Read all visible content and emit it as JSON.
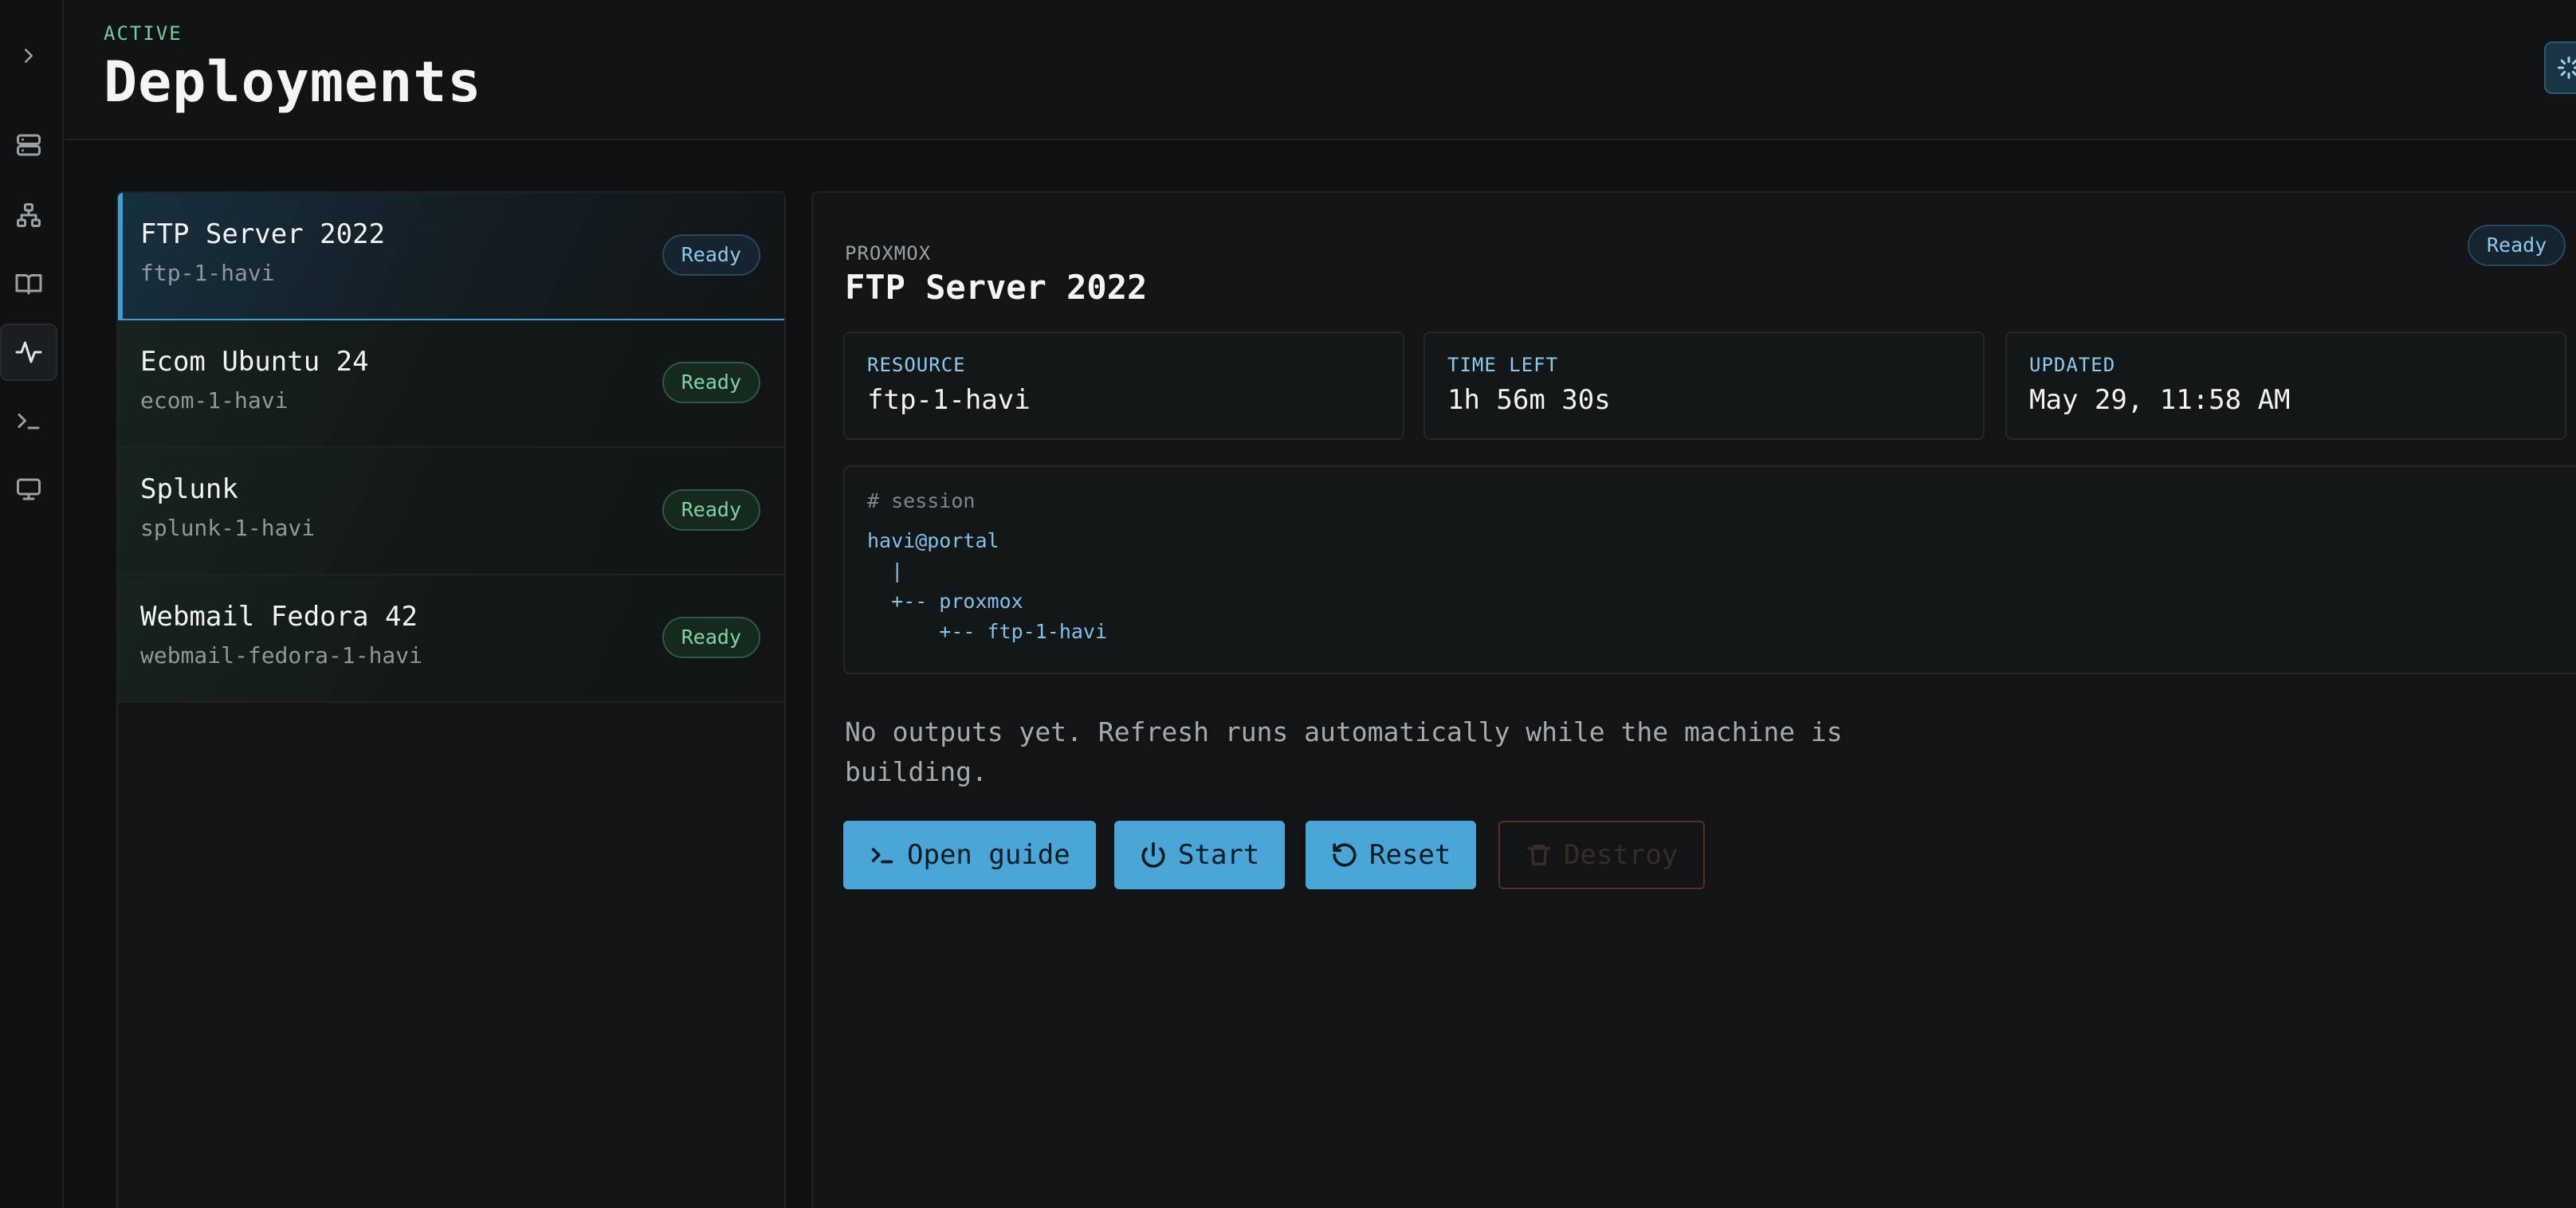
{
  "header": {
    "eyebrow": "ACTIVE",
    "title": "Deployments"
  },
  "rail": {
    "items": [
      {
        "icon": "chevron-right-icon"
      },
      {
        "icon": "server-icon"
      },
      {
        "icon": "network-icon"
      },
      {
        "icon": "book-icon"
      },
      {
        "icon": "activity-icon",
        "active": true
      },
      {
        "icon": "terminal-icon"
      },
      {
        "icon": "monitor-icon"
      }
    ]
  },
  "deployments": [
    {
      "name": "FTP Server 2022",
      "host": "ftp-1-havi",
      "status": "Ready",
      "selected": true
    },
    {
      "name": "Ecom Ubuntu 24",
      "host": "ecom-1-havi",
      "status": "Ready"
    },
    {
      "name": "Splunk",
      "host": "splunk-1-havi",
      "status": "Ready"
    },
    {
      "name": "Webmail Fedora 42",
      "host": "webmail-fedora-1-havi",
      "status": "Ready"
    }
  ],
  "detail": {
    "provider": "PROXMOX",
    "title": "FTP Server 2022",
    "status": "Ready",
    "stats": {
      "resource": {
        "label": "RESOURCE",
        "value": "ftp-1-havi"
      },
      "time_left": {
        "label": "TIME LEFT",
        "value": "1h 56m 30s"
      },
      "updated": {
        "label": "UPDATED",
        "value": "May 29, 11:58 AM"
      }
    },
    "session": {
      "comment": "# session",
      "lines": [
        "havi@portal",
        "  |",
        "  +-- proxmox",
        "      +-- ftp-1-havi"
      ]
    },
    "empty_message": "No outputs yet. Refresh runs automatically while the machine is building.",
    "actions": {
      "open_guide": "Open guide",
      "start": "Start",
      "reset": "Reset",
      "destroy": "Destroy"
    }
  },
  "colors": {
    "accent": "#49a6d6",
    "ready_green": "#7fd6a3",
    "ready_blue": "#8ccbee",
    "eyebrow": "#6fd39b"
  }
}
